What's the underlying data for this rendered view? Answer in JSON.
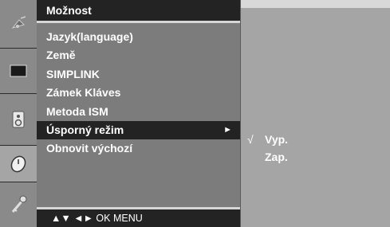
{
  "menu": {
    "title": "Možnost",
    "items": [
      {
        "label": "Jazyk(language)"
      },
      {
        "label": "Země"
      },
      {
        "label": "SIMPLINK"
      },
      {
        "label": "Zámek Kláves"
      },
      {
        "label": "Metoda ISM"
      },
      {
        "label": "Úsporný režim",
        "selected": true,
        "arrow": "►"
      },
      {
        "label": "Obnovit výchozí"
      }
    ],
    "footer": "▲▼  ◄►  OK  MENU"
  },
  "submenu": {
    "check_mark": "√",
    "options": [
      {
        "label": "Vyp.",
        "checked": true
      },
      {
        "label": "Zap.",
        "checked": false
      }
    ]
  },
  "icons": [
    "satellite-icon",
    "screen-icon",
    "speaker-icon",
    "clock-icon",
    "key-icon"
  ]
}
